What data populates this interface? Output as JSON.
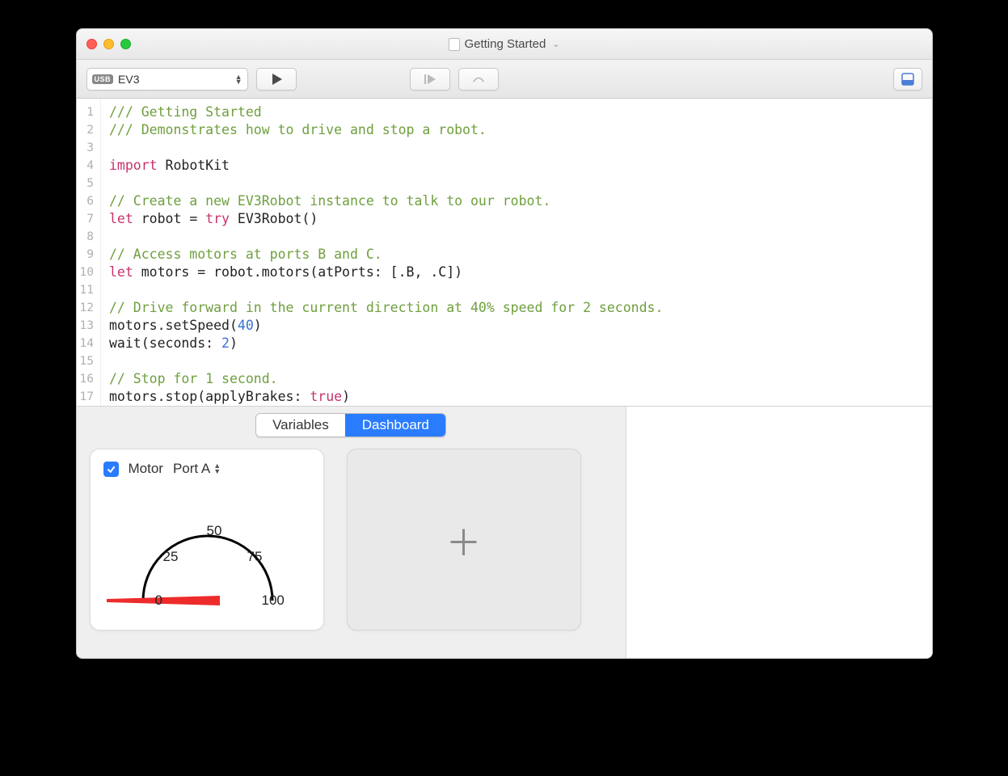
{
  "window": {
    "title": "Getting Started"
  },
  "toolbar": {
    "connection_badge": "USB",
    "connection_label": "EV3"
  },
  "code": {
    "lines": [
      {
        "n": 1,
        "tokens": [
          [
            "comment",
            "/// Getting Started"
          ]
        ]
      },
      {
        "n": 2,
        "tokens": [
          [
            "comment",
            "/// Demonstrates how to drive and stop a robot."
          ]
        ]
      },
      {
        "n": 3,
        "tokens": []
      },
      {
        "n": 4,
        "tokens": [
          [
            "keyword",
            "import"
          ],
          [
            "plain",
            " RobotKit"
          ]
        ]
      },
      {
        "n": 5,
        "tokens": []
      },
      {
        "n": 6,
        "tokens": [
          [
            "comment",
            "// Create a new EV3Robot instance to talk to our robot."
          ]
        ]
      },
      {
        "n": 7,
        "tokens": [
          [
            "keyword",
            "let"
          ],
          [
            "plain",
            " robot = "
          ],
          [
            "keyword",
            "try"
          ],
          [
            "plain",
            " EV3Robot()"
          ]
        ]
      },
      {
        "n": 8,
        "tokens": []
      },
      {
        "n": 9,
        "tokens": [
          [
            "comment",
            "// Access motors at ports B and C."
          ]
        ]
      },
      {
        "n": 10,
        "tokens": [
          [
            "keyword",
            "let"
          ],
          [
            "plain",
            " motors = robot.motors(atPorts: [.B, .C])"
          ]
        ]
      },
      {
        "n": 11,
        "tokens": []
      },
      {
        "n": 12,
        "tokens": [
          [
            "comment",
            "// Drive forward in the current direction at 40% speed for 2 seconds."
          ]
        ]
      },
      {
        "n": 13,
        "tokens": [
          [
            "plain",
            "motors.setSpeed("
          ],
          [
            "num",
            "40"
          ],
          [
            "plain",
            ")"
          ]
        ]
      },
      {
        "n": 14,
        "tokens": [
          [
            "plain",
            "wait(seconds: "
          ],
          [
            "num",
            "2"
          ],
          [
            "plain",
            ")"
          ]
        ]
      },
      {
        "n": 15,
        "tokens": []
      },
      {
        "n": 16,
        "tokens": [
          [
            "comment",
            "// Stop for 1 second."
          ]
        ]
      },
      {
        "n": 17,
        "tokens": [
          [
            "plain",
            "motors.stop(applyBrakes: "
          ],
          [
            "kwtrue",
            "true"
          ],
          [
            "plain",
            ")"
          ]
        ]
      }
    ]
  },
  "tabs": {
    "variables": "Variables",
    "dashboard": "Dashboard",
    "active": "dashboard"
  },
  "widget": {
    "checked": true,
    "type_label": "Motor",
    "port_label": "Port A",
    "ticks": {
      "t0": "0",
      "t25": "25",
      "t50": "50",
      "t75": "75",
      "t100": "100"
    },
    "value": 0
  }
}
